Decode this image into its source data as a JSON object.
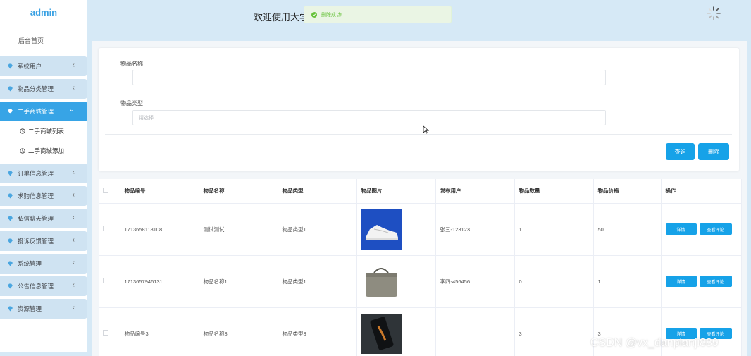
{
  "sidebar": {
    "logo": "admin",
    "home": "后台首页",
    "items": [
      {
        "label": "系统用户"
      },
      {
        "label": "物品分类管理"
      },
      {
        "label": "二手商城管理"
      },
      {
        "label": "订单信息管理"
      },
      {
        "label": "求购信息管理"
      },
      {
        "label": "私信聊天管理"
      },
      {
        "label": "投诉反馈管理"
      },
      {
        "label": "系统管理"
      },
      {
        "label": "公告信息管理"
      },
      {
        "label": "资源管理"
      }
    ],
    "sub_items": [
      {
        "label": "二手商城列表"
      },
      {
        "label": "二手商城添加"
      }
    ]
  },
  "header": {
    "welcome": "欢迎使用大学",
    "toast": "删除成功!"
  },
  "search": {
    "name_label": "物品名称",
    "name_value": "",
    "type_label": "物品类型",
    "type_placeholder": "请选择",
    "query_button": "查询",
    "delete_button": "删除"
  },
  "table": {
    "headers": [
      "物品编号",
      "物品名称",
      "物品类型",
      "物品图片",
      "发布用户",
      "物品数量",
      "物品价格",
      "操作"
    ],
    "rows": [
      {
        "id": "1713658118108",
        "name": "测试测试",
        "type": "物品类型1",
        "user": "张三-123123",
        "qty": "1",
        "price": "50"
      },
      {
        "id": "1713657946131",
        "name": "物品名称1",
        "type": "物品类型1",
        "user": "李四-456456",
        "qty": "0",
        "price": "1"
      },
      {
        "id": "物品编号3",
        "name": "物品名称3",
        "type": "物品类型3",
        "user": "",
        "qty": "3",
        "price": "3"
      }
    ],
    "detail_button": "详情",
    "review_button": "查看评论"
  },
  "watermark": "CSDN @vx_danpianji889",
  "colors": {
    "accent": "#16a2e8",
    "sidebar_active": "#37a4e6",
    "background": "#d6e9f6"
  }
}
